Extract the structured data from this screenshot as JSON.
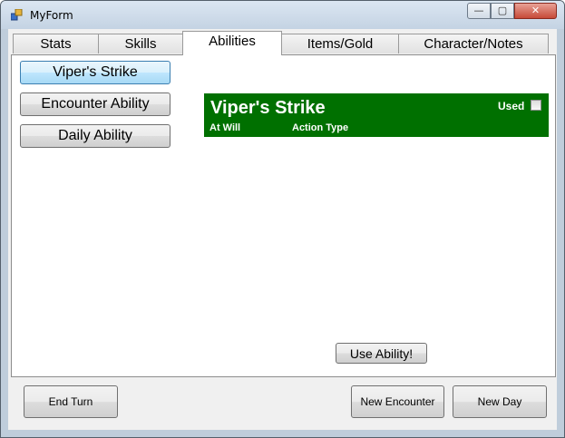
{
  "window": {
    "title": "MyForm",
    "icon": "form-icon",
    "controls": {
      "minimize": "minimize-icon",
      "maximize": "maximize-icon",
      "close": "close-icon"
    }
  },
  "tabs": [
    {
      "label": "Stats"
    },
    {
      "label": "Skills"
    },
    {
      "label": "Abilities",
      "active": true
    },
    {
      "label": "Items/Gold"
    },
    {
      "label": "Character/Notes"
    }
  ],
  "abilities_list": [
    {
      "label": "Viper's Strike",
      "selected": true
    },
    {
      "label": "Encounter Ability"
    },
    {
      "label": "Daily Ability"
    }
  ],
  "ability_detail": {
    "name": "Viper's Strike",
    "used_label": "Used",
    "used": false,
    "frequency": "At Will",
    "action_type": "Action Type",
    "color": "#007000"
  },
  "use_button": "Use Ability!",
  "footer": {
    "end_turn": "End Turn",
    "new_encounter": "New Encounter",
    "new_day": "New Day"
  }
}
